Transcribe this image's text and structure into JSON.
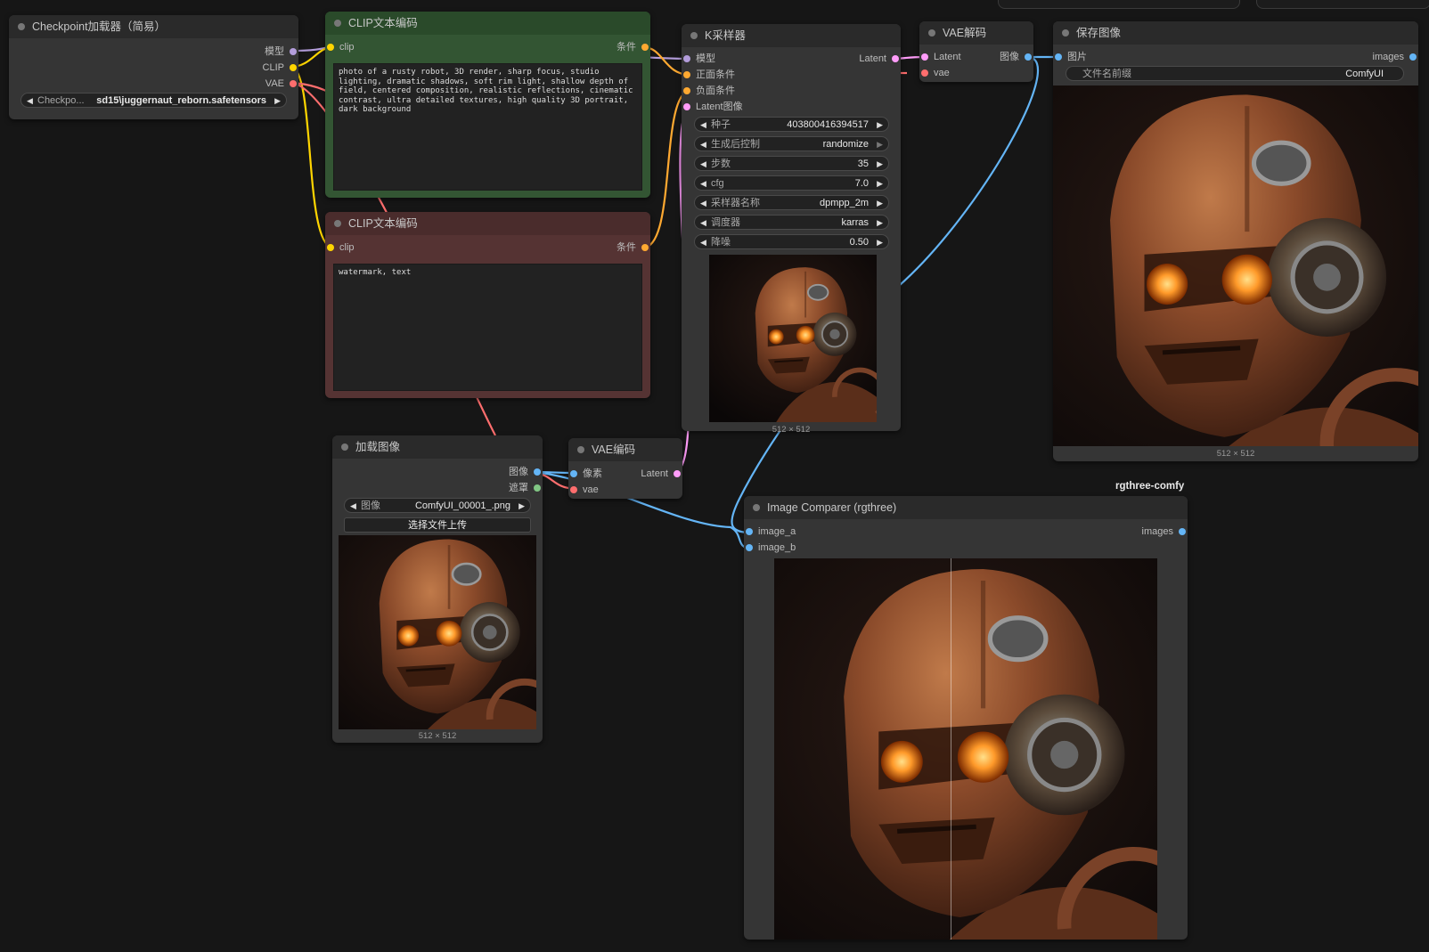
{
  "colors": {
    "model": "#b39ddb",
    "clip": "#ffd500",
    "vae": "#ff6e6e",
    "conditioning": "#ffa931",
    "latent": "#ff9cf9",
    "image": "#64b5f6",
    "mask": "#81c784",
    "positive_node": "#335533",
    "negative_node": "#553333",
    "canvas": "#161616"
  },
  "checkpoint": {
    "title": "Checkpoint加载器（简易）",
    "outputs": [
      "模型",
      "CLIP",
      "VAE"
    ],
    "widget_label": "Checkpo...",
    "widget_value": "sd15\\juggernaut_reborn.safetensors"
  },
  "clip_positive": {
    "title": "CLIP文本编码",
    "input": "clip",
    "output": "条件",
    "text": "photo of a rusty robot, 3D render, sharp focus, studio lighting, dramatic shadows, soft rim light, shallow depth of field, centered composition, realistic reflections, cinematic contrast, ultra detailed textures, high quality 3D portrait, dark background"
  },
  "clip_negative": {
    "title": "CLIP文本编码",
    "input": "clip",
    "output": "条件",
    "text": "watermark, text"
  },
  "ksampler": {
    "title": "K采样器",
    "inputs": [
      "模型",
      "正面条件",
      "负面条件",
      "Latent图像"
    ],
    "output": "Latent",
    "widgets": [
      {
        "label": "种子",
        "value": "403800416394517"
      },
      {
        "label": "生成后控制",
        "value": "randomize"
      },
      {
        "label": "步数",
        "value": "35"
      },
      {
        "label": "cfg",
        "value": "7.0"
      },
      {
        "label": "采样器名称",
        "value": "dpmpp_2m"
      },
      {
        "label": "调度器",
        "value": "karras"
      },
      {
        "label": "降噪",
        "value": "0.50"
      }
    ],
    "preview_size": "512 × 512"
  },
  "vae_decode": {
    "title": "VAE解码",
    "inputs": [
      "Latent",
      "vae"
    ],
    "output": "图像"
  },
  "save_image": {
    "title": "保存图像",
    "input": "图片",
    "output": "images",
    "widget_label": "文件名前缀",
    "widget_value": "ComfyUI",
    "preview_size": "512 × 512"
  },
  "load_image": {
    "title": "加载图像",
    "outputs": [
      "图像",
      "遮罩"
    ],
    "widget_label": "图像",
    "widget_value": "ComfyUI_00001_.png",
    "upload_label": "选择文件上传",
    "preview_size": "512 × 512"
  },
  "vae_encode": {
    "title": "VAE编码",
    "inputs": [
      "像素",
      "vae"
    ],
    "output": "Latent"
  },
  "image_comparer": {
    "badge": "rgthree-comfy",
    "title": "Image Comparer (rgthree)",
    "inputs": [
      "image_a",
      "image_b"
    ],
    "output": "images"
  }
}
